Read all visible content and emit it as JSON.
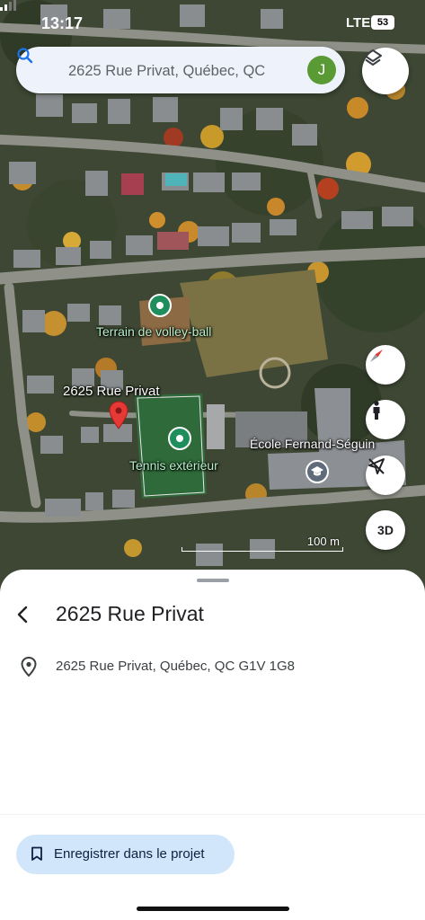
{
  "status_bar": {
    "time": "13:17",
    "network": "LTE",
    "battery": "53"
  },
  "search": {
    "value": "2625 Rue Privat, Québec, QC",
    "avatar_initial": "J"
  },
  "map": {
    "labels": {
      "volleyball": "Terrain de volley-ball",
      "address_pin": "2625 Rue Privat",
      "tennis": "Tennis extérieur",
      "school": "École Fernand-Séguin"
    },
    "scale": "100 m",
    "button_3d": "3D"
  },
  "place_sheet": {
    "title": "2625 Rue Privat",
    "address": "2625 Rue Privat, Québec, QC G1V 1G8",
    "save_button": "Enregistrer dans le projet"
  },
  "icons": [
    "search-icon",
    "layers-icon",
    "compass-icon",
    "pegman-icon",
    "location-off-icon",
    "back-icon",
    "pin-outline-icon",
    "bookmark-icon",
    "red-pin-icon"
  ],
  "colors": {
    "accent_blue": "#1a73e8",
    "poi_green": "#1e8e5c",
    "save_button_bg": "#d2e6fb",
    "avatar_green": "#5a9a35",
    "pin_red": "#e53935"
  }
}
